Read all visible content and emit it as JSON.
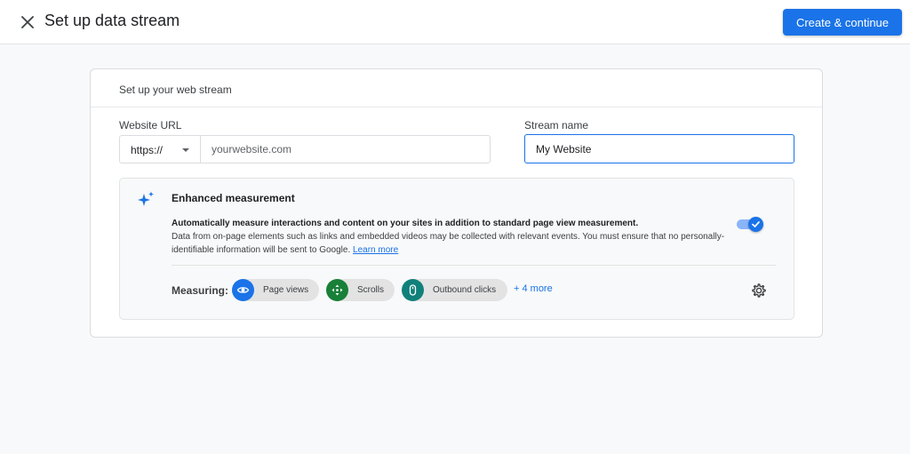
{
  "header": {
    "title": "Set up data stream",
    "primary_button": "Create & continue"
  },
  "card": {
    "title": "Set up your web stream",
    "website_url": {
      "label": "Website URL",
      "protocol": "https://",
      "placeholder": "yourwebsite.com"
    },
    "stream_name": {
      "label": "Stream name",
      "value": "My Website"
    },
    "enhanced_measurement": {
      "title": "Enhanced measurement",
      "description_bold": "Automatically measure interactions and content on your sites in addition to standard page view measurement.",
      "description": "Data from on-page elements such as links and embedded videos may be collected with relevant events. You must ensure that no personally-identifiable information will be sent to Google.",
      "learn_more": "Learn more",
      "enabled": true,
      "measuring_label": "Measuring:",
      "chips": [
        {
          "label": "Page views",
          "icon": "eye-icon",
          "color": "#1a73e8"
        },
        {
          "label": "Scrolls",
          "icon": "scroll-arrows-icon",
          "color": "#188038"
        },
        {
          "label": "Outbound clicks",
          "icon": "mouse-icon",
          "color": "#12807a"
        }
      ],
      "more_link": "+ 4 more"
    }
  },
  "colors": {
    "accent": "#1a73e8",
    "background": "#f8f9fa"
  }
}
